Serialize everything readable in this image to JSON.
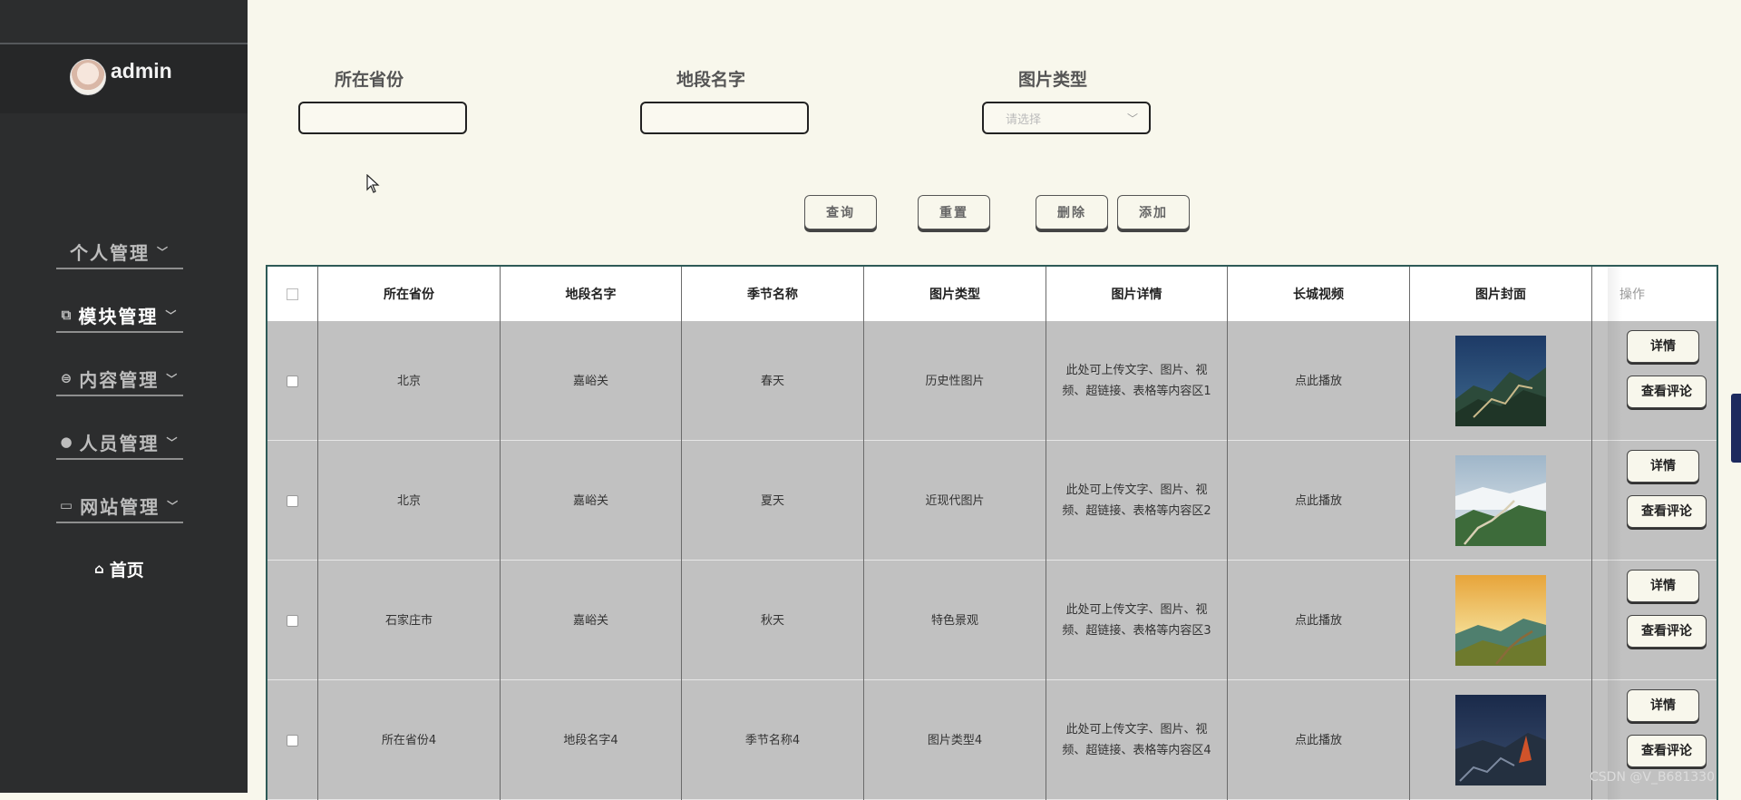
{
  "sidebar": {
    "username": "admin",
    "menu": [
      {
        "label": "个人管理",
        "icon": "",
        "active": false
      },
      {
        "label": "模块管理",
        "icon": "copy-icon",
        "active": true
      },
      {
        "label": "内容管理",
        "icon": "message-icon",
        "active": false
      },
      {
        "label": "人员管理",
        "icon": "user-icon",
        "active": false
      },
      {
        "label": "网站管理",
        "icon": "monitor-icon",
        "active": false
      }
    ],
    "home_label": "首页"
  },
  "search": {
    "province_label": "所在省份",
    "section_label": "地段名字",
    "type_label": "图片类型",
    "province_value": "",
    "section_value": "",
    "type_placeholder": "请选择"
  },
  "actions": {
    "query": "查询",
    "reset": "重置",
    "delete": "删除",
    "add": "添加"
  },
  "table": {
    "headers": [
      "所在省份",
      "地段名字",
      "季节名称",
      "图片类型",
      "图片详情",
      "长城视频",
      "图片封面",
      "操作"
    ],
    "rows": [
      {
        "province": "北京",
        "section": "嘉峪关",
        "season": "春天",
        "type": "历史性图片",
        "detail": "此处可上传文字、图片、视频、超链接、表格等内容区1",
        "video": "点此播放"
      },
      {
        "province": "北京",
        "section": "嘉峪关",
        "season": "夏天",
        "type": "近现代图片",
        "detail": "此处可上传文字、图片、视频、超链接、表格等内容区2",
        "video": "点此播放"
      },
      {
        "province": "石家庄市",
        "section": "嘉峪关",
        "season": "秋天",
        "type": "特色景观",
        "detail": "此处可上传文字、图片、视频、超链接、表格等内容区3",
        "video": "点此播放"
      },
      {
        "province": "所在省份4",
        "section": "地段名字4",
        "season": "季节名称4",
        "type": "图片类型4",
        "detail": "此处可上传文字、图片、视频、超链接、表格等内容区4",
        "video": "点此播放"
      }
    ],
    "row_buttons": {
      "detail": "详情",
      "comments": "查看评论"
    }
  },
  "watermark": "CSDN @V_B681330",
  "colors": {
    "sidebar_bg": "#2c2d2e",
    "page_bg": "#f8f7ec",
    "table_border": "#2e5a57",
    "row_bg": "#c1c1c1"
  }
}
